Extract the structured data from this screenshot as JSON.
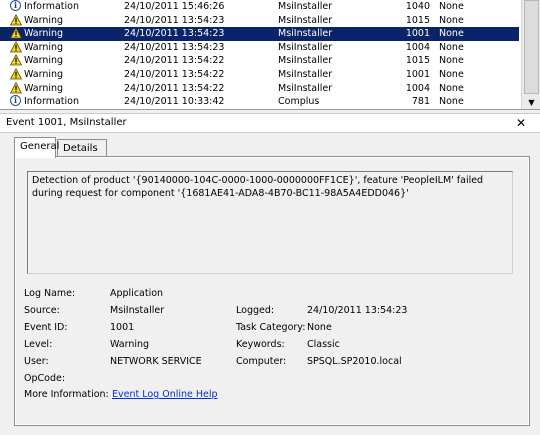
{
  "event_list": {
    "rows": [
      {
        "level": "Information",
        "date": "24/10/2011 15:46:26",
        "source": "MsiInstaller",
        "event_id": "1040",
        "task": "None",
        "icon": "info-icon"
      },
      {
        "level": "Warning",
        "date": "24/10/2011 13:54:23",
        "source": "MsiInstaller",
        "event_id": "1015",
        "task": "None",
        "icon": "warning-icon"
      },
      {
        "level": "Warning",
        "date": "24/10/2011 13:54:23",
        "source": "MsiInstaller",
        "event_id": "1001",
        "task": "None",
        "icon": "warning-icon",
        "selected": true
      },
      {
        "level": "Warning",
        "date": "24/10/2011 13:54:23",
        "source": "MsiInstaller",
        "event_id": "1004",
        "task": "None",
        "icon": "warning-icon"
      },
      {
        "level": "Warning",
        "date": "24/10/2011 13:54:22",
        "source": "MsiInstaller",
        "event_id": "1015",
        "task": "None",
        "icon": "warning-icon"
      },
      {
        "level": "Warning",
        "date": "24/10/2011 13:54:22",
        "source": "MsiInstaller",
        "event_id": "1001",
        "task": "None",
        "icon": "warning-icon"
      },
      {
        "level": "Warning",
        "date": "24/10/2011 13:54:22",
        "source": "MsiInstaller",
        "event_id": "1004",
        "task": "None",
        "icon": "warning-icon"
      },
      {
        "level": "Information",
        "date": "24/10/2011 10:33:42",
        "source": "Complus",
        "event_id": "781",
        "task": "None",
        "icon": "info-icon"
      }
    ],
    "scroll_down_glyph": "▼"
  },
  "detail": {
    "title": "Event 1001, MsiInstaller",
    "close_glyph": "✕",
    "tabs": {
      "general": "General",
      "details": "Details"
    },
    "description": "Detection of product '{90140000-104C-0000-1000-0000000FF1CE}', feature 'PeopleILM' failed during request for component '{1681AE41-ADA8-4B70-BC11-98A5A4EDD046}'",
    "props": {
      "log_name_label": "Log Name:",
      "log_name": "Application",
      "source_label": "Source:",
      "source": "MsiInstaller",
      "logged_label": "Logged:",
      "logged": "24/10/2011 13:54:23",
      "event_id_label": "Event ID:",
      "event_id": "1001",
      "task_category_label": "Task Category:",
      "task_category": "None",
      "level_label": "Level:",
      "level": "Warning",
      "keywords_label": "Keywords:",
      "keywords": "Classic",
      "user_label": "User:",
      "user": "NETWORK SERVICE",
      "computer_label": "Computer:",
      "computer": "SPSQL.SP2010.local",
      "opcode_label": "OpCode:",
      "opcode": "",
      "more_info_label": "More Information:",
      "more_info_link": "Event Log Online Help"
    }
  },
  "colors": {
    "selection": "#0a246a",
    "link": "#0033cc",
    "warning_fill": "#f5d21f"
  }
}
